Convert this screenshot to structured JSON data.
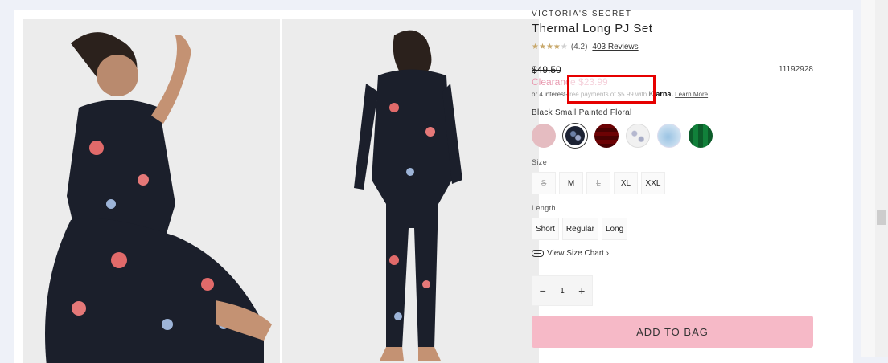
{
  "product": {
    "brand": "VICTORIA'S SECRET",
    "title": "Thermal Long PJ Set",
    "rating": 4.2,
    "rating_text": "(4.2)",
    "reviews_link": "403 Reviews",
    "old_price": "$49.50",
    "sku": "11192928",
    "clearance_label": "Clearance $23.99",
    "klarna_prefix": "or 4 interest-free payments of $5.99 with",
    "klarna_brand": "Klarna.",
    "klarna_link": "Learn More",
    "color_name": "Black Small Painted Floral",
    "swatches": [
      "pink",
      "black-small-painted-floral",
      "red-plaid",
      "white-floral",
      "light-blue",
      "green-plaid"
    ],
    "selected_swatch": "black-small-painted-floral"
  },
  "size": {
    "label": "Size",
    "options": [
      {
        "label": "S",
        "available": false
      },
      {
        "label": "M",
        "available": true
      },
      {
        "label": "L",
        "available": false
      },
      {
        "label": "XL",
        "available": true
      },
      {
        "label": "XXL",
        "available": true
      }
    ]
  },
  "length": {
    "label": "Length",
    "options": [
      "Short",
      "Regular",
      "Long"
    ]
  },
  "size_chart_link": "View Size Chart ›",
  "quantity": {
    "minus": "−",
    "value": "1",
    "plus": "+"
  },
  "add_to_bag": "ADD TO BAG",
  "colors": {
    "clearance": "#e89ab0",
    "add_to_bag_bg": "#f6b9c7",
    "highlight_box": "#e60000"
  }
}
